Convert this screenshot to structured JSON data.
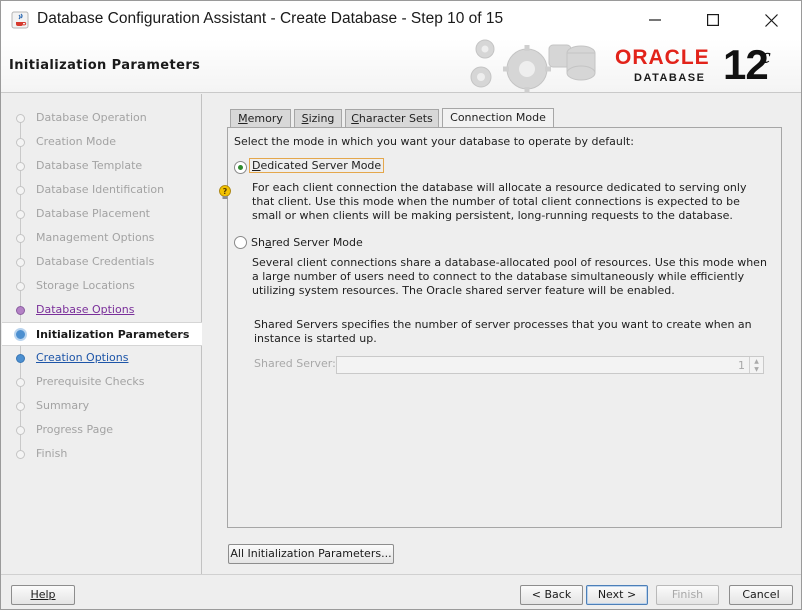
{
  "window": {
    "title": "Database Configuration Assistant - Create Database - Step 10 of 15"
  },
  "header": {
    "page_heading": "Initialization Parameters",
    "brand": "ORACLE",
    "product": "DATABASE",
    "version": "12",
    "version_suffix": "c"
  },
  "steps": [
    {
      "label": "Database Operation",
      "state": "disabled"
    },
    {
      "label": "Creation Mode",
      "state": "disabled"
    },
    {
      "label": "Database Template",
      "state": "disabled"
    },
    {
      "label": "Database Identification",
      "state": "disabled"
    },
    {
      "label": "Database Placement",
      "state": "disabled"
    },
    {
      "label": "Management Options",
      "state": "disabled"
    },
    {
      "label": "Database Credentials",
      "state": "disabled"
    },
    {
      "label": "Storage Locations",
      "state": "disabled"
    },
    {
      "label": "Database Options",
      "state": "done"
    },
    {
      "label": "Initialization Parameters",
      "state": "current"
    },
    {
      "label": "Creation Options",
      "state": "next"
    },
    {
      "label": "Prerequisite Checks",
      "state": "disabled"
    },
    {
      "label": "Summary",
      "state": "disabled"
    },
    {
      "label": "Progress Page",
      "state": "disabled"
    },
    {
      "label": "Finish",
      "state": "disabled"
    }
  ],
  "tabs": [
    {
      "label": "Memory",
      "mnemonic": "M",
      "rest": "emory",
      "active": false
    },
    {
      "label": "Sizing",
      "mnemonic": "S",
      "rest": "izing",
      "active": false
    },
    {
      "label": "Character Sets",
      "mnemonic": "C",
      "rest": "haracter Sets",
      "active": false
    },
    {
      "label": "Connection Mode",
      "mnemonic": "",
      "rest": "Connection Mode",
      "active": true
    }
  ],
  "connection_mode": {
    "intro": "Select the mode in which you want your database to operate by default:",
    "dedicated": {
      "label": "Dedicated Server Mode",
      "mnemonic": "D",
      "rest": "edicated Server Mode",
      "selected": true,
      "description": "For each client connection the database will allocate a resource dedicated to serving only that client.  Use this mode when the number of total client connections is expected to be small or when clients will be making persistent, long-running requests to the database."
    },
    "shared": {
      "label": "Shared Server Mode",
      "pre": "Sh",
      "mnemonic": "a",
      "rest": "red Server Mode",
      "selected": false,
      "description": "Several client connections share a database-allocated pool of resources.  Use this mode when a large number of users need to connect to the database simultaneously while efficiently utilizing system resources.  The Oracle shared server feature will be enabled.",
      "servers_note": "Shared Servers specifies the number of server processes that you want to create when an instance is started up.",
      "shared_server_label": "Shared Server:",
      "shared_server_value": "1"
    }
  },
  "buttons": {
    "all_params": "All Initialization Parameters...",
    "help": "Help",
    "back": "< Back",
    "next": "Next >",
    "finish": "Finish",
    "cancel": "Cancel"
  },
  "colors": {
    "oracle_red": "#e2231a",
    "step_done": "#7a2f9a",
    "step_link": "#1d55a8"
  }
}
